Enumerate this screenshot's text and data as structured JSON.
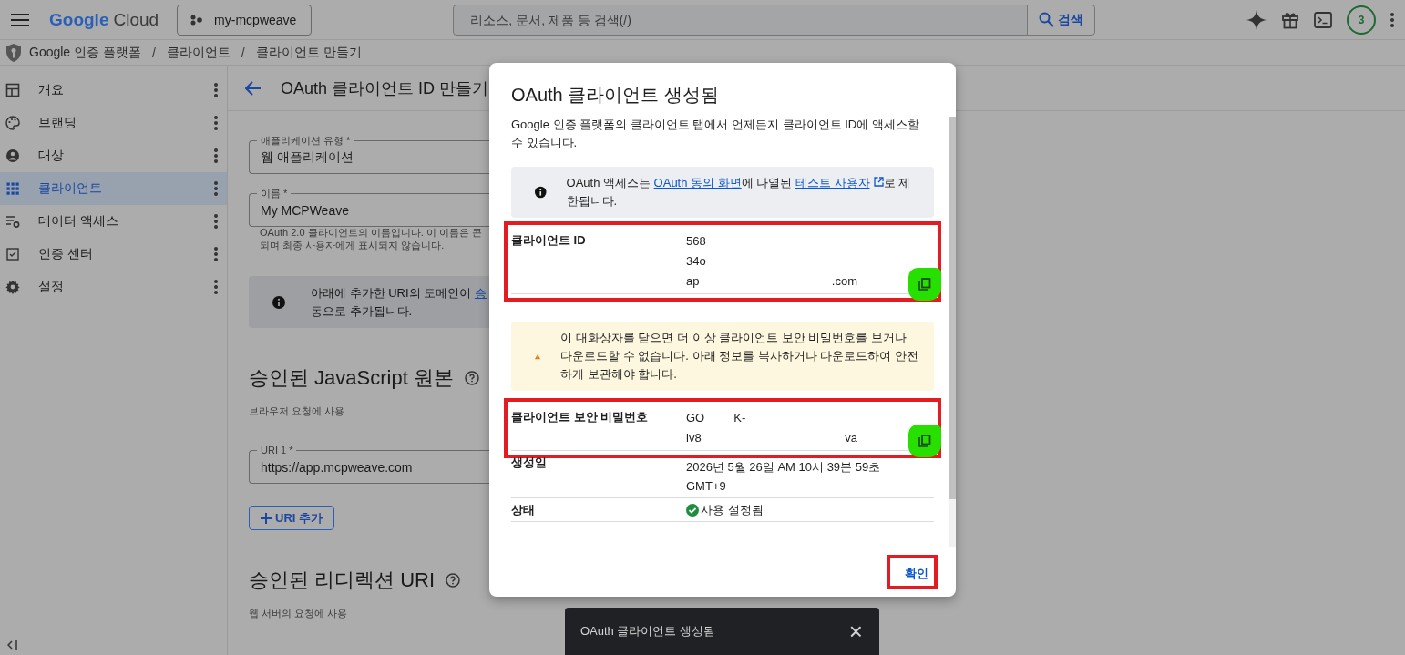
{
  "header": {
    "logo": {
      "first": "Google",
      "second": "Cloud"
    },
    "project": "my-mcpweave",
    "search": {
      "placeholder": "리소스, 문서, 제품 등 검색(/)",
      "button": "검색"
    },
    "notifications": "3"
  },
  "breadcrumb": {
    "items": [
      "Google 인증 플랫폼",
      "클라이언트",
      "클라이언트 만들기"
    ],
    "separator": "/"
  },
  "sidebar": {
    "items": [
      {
        "label": "개요",
        "selected": false
      },
      {
        "label": "브랜딩",
        "selected": false
      },
      {
        "label": "대상",
        "selected": false
      },
      {
        "label": "클라이언트",
        "selected": true
      },
      {
        "label": "데이터 액세스",
        "selected": false
      },
      {
        "label": "인증 센터",
        "selected": false
      },
      {
        "label": "설정",
        "selected": false
      }
    ]
  },
  "page": {
    "title": "OAuth 클라이언트 ID 만들기",
    "fields": [
      {
        "label": "애플리케이션 유형 *",
        "value": "웹 애플리케이션"
      },
      {
        "label": "이름 *",
        "value": "My MCPWeave"
      }
    ],
    "name_hint": [
      "OAuth 2.0 클라이언트의 이름입니다. 이 이름은 콘",
      "되며 최종 사용자에게 표시되지 않습니다."
    ],
    "info": {
      "before": "아래에 추가한 URI의 도메인이 ",
      "link": "승",
      "line2": "동으로 추가됩니다."
    },
    "sections": [
      {
        "heading": "승인된 JavaScript 원본",
        "subtitle": "브라우저 요청에 사용",
        "uris": [
          {
            "label": "URI 1 *",
            "value": "https://app.mcpweave.com"
          }
        ],
        "add_button": "URI 추가"
      },
      {
        "heading": "승인된 리디렉션 URI",
        "subtitle": "웹 서버의 요청에 사용"
      }
    ]
  },
  "dialog": {
    "title": "OAuth 클라이언트 생성됨",
    "intro": "Google 인증 플랫폼의 클라이언트 탭에서 언제든지 클라이언트 ID에 액세스할 수 있습니다.",
    "info": {
      "before": "OAuth 액세스는 ",
      "link1": "OAuth 동의 화면",
      "middle": "에 나열된 ",
      "link2": "테스트 사용자",
      "after": "로 제한됩니다."
    },
    "warning": "이 대화상자를 닫으면 더 이상 클라이언트 보안 비밀번호를 보거나 다운로드할 수 없습니다. 아래 정보를 복사하거나 다운로드하여 안전하게 보관해야 합니다.",
    "rows": [
      {
        "kind": "secret",
        "label": "클라이언트 ID",
        "highlighted": true,
        "lines": [
          {
            "kind": "single",
            "parts": [
              "568"
            ]
          },
          {
            "kind": "single",
            "parts": [
              "34o"
            ]
          },
          {
            "kind": "spread",
            "parts": [
              "ap",
              ".com"
            ]
          }
        ]
      },
      {
        "kind": "secret",
        "label": "클라이언트 보안 비밀번호",
        "highlighted": true,
        "lines": [
          {
            "kind": "near",
            "parts": [
              "GO",
              "K-"
            ]
          },
          {
            "kind": "spread",
            "parts": [
              "iv8",
              "va"
            ]
          }
        ]
      },
      {
        "kind": "text",
        "label": "생성일",
        "value": "2026년 5월 26일 AM 10시 39분 59초 GMT+9"
      },
      {
        "kind": "status",
        "label": "상태",
        "value": "사용 설정됨"
      }
    ],
    "ok_button": "확인",
    "ok_highlighted": true
  },
  "toast": {
    "message": "OAuth 클라이언트 생성됨",
    "close": "×"
  }
}
